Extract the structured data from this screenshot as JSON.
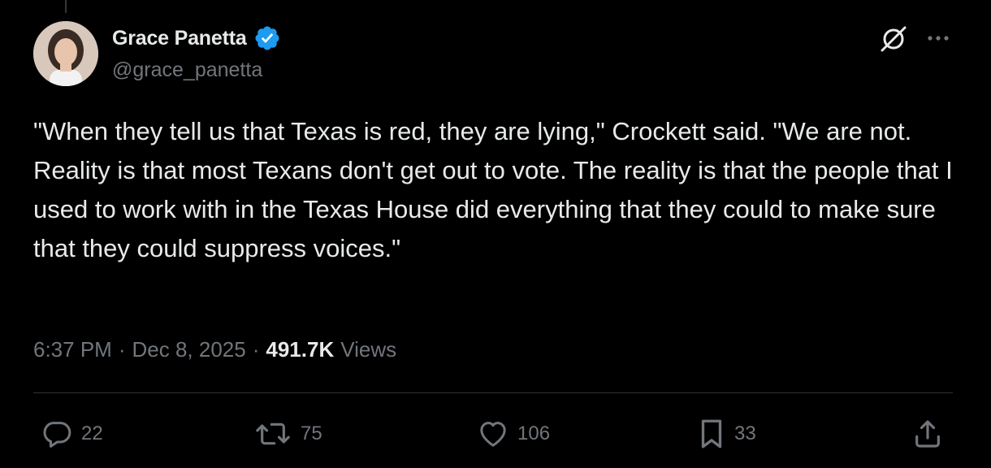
{
  "author": {
    "display_name": "Grace Panetta",
    "handle": "@grace_panetta",
    "verified": true
  },
  "tweet": {
    "text": "\"When they tell us that Texas is red, they are lying,\" Crockett said. \"We are not. Reality is that most Texans don't get out to vote. The reality is that the people that I used to work with in the Texas House did everything that they could to make sure that they could suppress voices.\"",
    "time": "6:37 PM",
    "date": "Dec 8, 2025",
    "separator": "·",
    "views_count": "491.7K",
    "views_label": "Views"
  },
  "actions": {
    "replies": "22",
    "reposts": "75",
    "likes": "106",
    "bookmarks": "33"
  },
  "icons": {
    "verified": "verified-badge-icon",
    "grok": "grok-icon",
    "more": "more-icon",
    "reply": "reply-icon",
    "repost": "repost-icon",
    "like": "heart-icon",
    "bookmark": "bookmark-icon",
    "share": "share-icon"
  },
  "colors": {
    "background": "#000000",
    "text_primary": "#e7e9ea",
    "text_secondary": "#71767b",
    "verified_blue": "#1d9bf0",
    "divider": "#2f3336"
  }
}
